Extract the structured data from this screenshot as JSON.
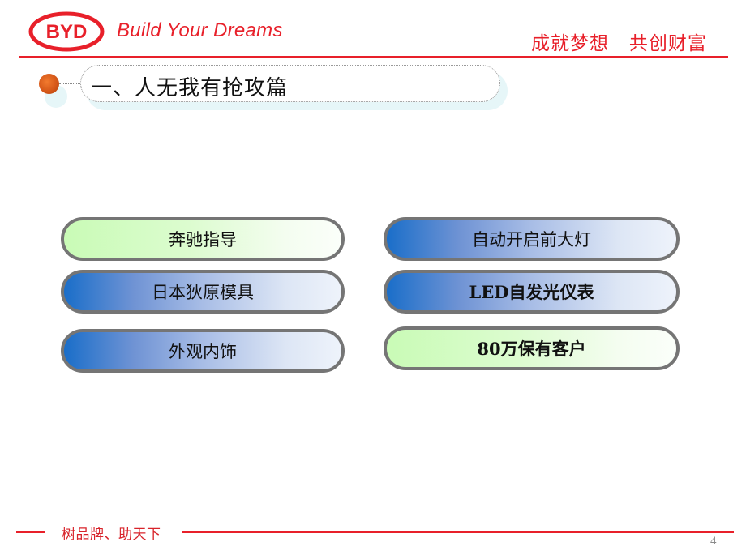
{
  "header": {
    "logo_text": "BYD",
    "slogan_en": "Build Your Dreams",
    "slogan_cn": "成就梦想   共创财富",
    "brand_color": "#e8202a"
  },
  "section": {
    "title": "一、人无我有抢攻篇"
  },
  "features": {
    "left": [
      {
        "label": "奔驰指导",
        "style": "green"
      },
      {
        "label": "日本狄原模具",
        "style": "blue"
      },
      {
        "label": "外观内饰",
        "style": "blue"
      }
    ],
    "right": [
      {
        "label": "自动开启前大灯",
        "style": "blue"
      },
      {
        "label": "LED自发光仪表",
        "style": "blue"
      },
      {
        "label": "80万保有客户",
        "style": "green"
      }
    ]
  },
  "footer": {
    "text": "树品牌、助天下",
    "page_number": "4"
  }
}
